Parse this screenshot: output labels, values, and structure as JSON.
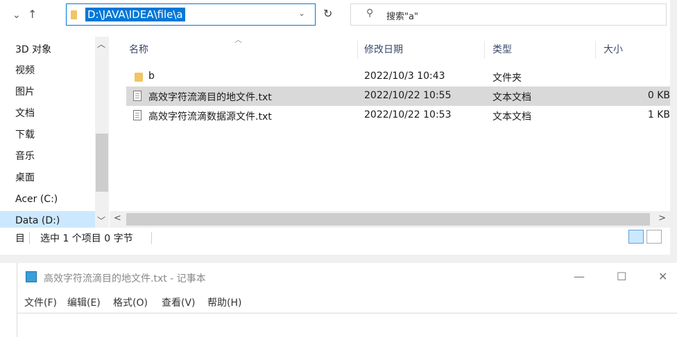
{
  "address": {
    "path": "D:\\JAVA\\IDEA\\file\\a"
  },
  "search": {
    "placeholder": "搜索\"a\""
  },
  "sidebar": {
    "items": [
      {
        "label": "3D 对象"
      },
      {
        "label": "视频"
      },
      {
        "label": "图片"
      },
      {
        "label": "文档"
      },
      {
        "label": "下载"
      },
      {
        "label": "音乐"
      },
      {
        "label": "桌面"
      },
      {
        "label": "Acer (C:)"
      },
      {
        "label": "Data (D:)"
      }
    ]
  },
  "columns": {
    "name": "名称",
    "modified": "修改日期",
    "type": "类型",
    "size": "大小"
  },
  "files": [
    {
      "name": "b",
      "modified": "2022/10/3 10:43",
      "type": "文件夹",
      "size": ""
    },
    {
      "name": "高效字符流滴目的地文件.txt",
      "modified": "2022/10/22 10:55",
      "type": "文本文档",
      "size": "0 KB"
    },
    {
      "name": "高效字符流滴数据源文件.txt",
      "modified": "2022/10/22 10:53",
      "type": "文本文档",
      "size": "1 KB"
    }
  ],
  "status": {
    "lead": "目",
    "selection": "选中 1 个项目  0 字节"
  },
  "notepad": {
    "title": "高效字符流滴目的地文件.txt - 记事本",
    "menu": [
      "文件(F)",
      "编辑(E)",
      "格式(O)",
      "查看(V)",
      "帮助(H)"
    ]
  }
}
